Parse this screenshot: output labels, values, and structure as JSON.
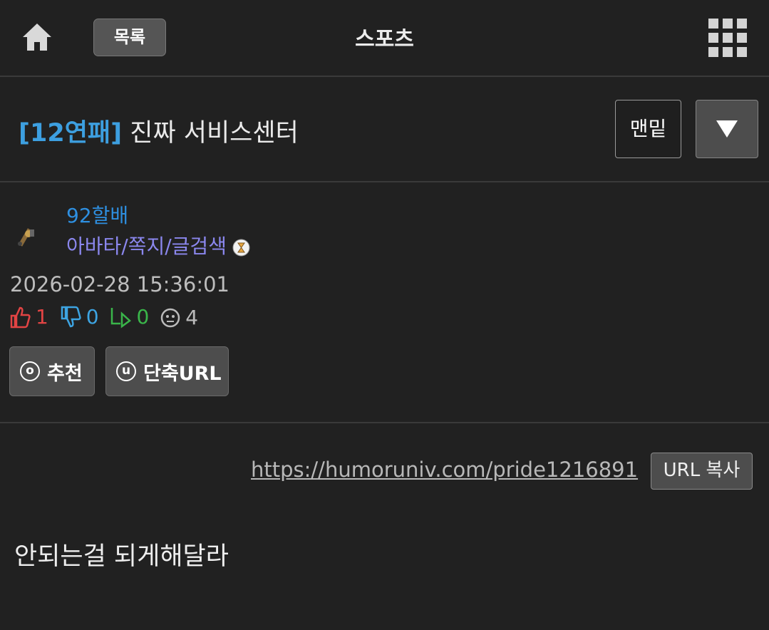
{
  "header": {
    "list_label": "목록",
    "board_title": "스포츠",
    "home_icon": "home-icon",
    "menu_icon": "grid-menu-icon"
  },
  "post": {
    "tag": "[12연패]",
    "title": "진짜 서비스센터",
    "bottom_label": "맨밑",
    "down_icon": "triangle-down-icon",
    "author": {
      "nickname": "92할배",
      "links": "아바타/쪽지/글검색"
    },
    "date": "2026-02-28 15:36:01",
    "stats": {
      "likes": "1",
      "dislikes": "0",
      "replies": "0",
      "views": "4"
    },
    "recommend_label": "추천",
    "recommend_circle": "o",
    "short_url_label": "단축URL",
    "short_url_circle": "u",
    "url": "https://humoruniv.com/pride1216891",
    "copy_url_label": "URL 복사",
    "content": "안되는걸 되게해달라"
  },
  "colors": {
    "background": "#212121",
    "tag": "#3d9fe0",
    "nickname": "#2e8fe0",
    "links": "#8b87ee",
    "like": "#e24444",
    "dislike": "#3da4e2",
    "reply": "#3ab54a"
  }
}
